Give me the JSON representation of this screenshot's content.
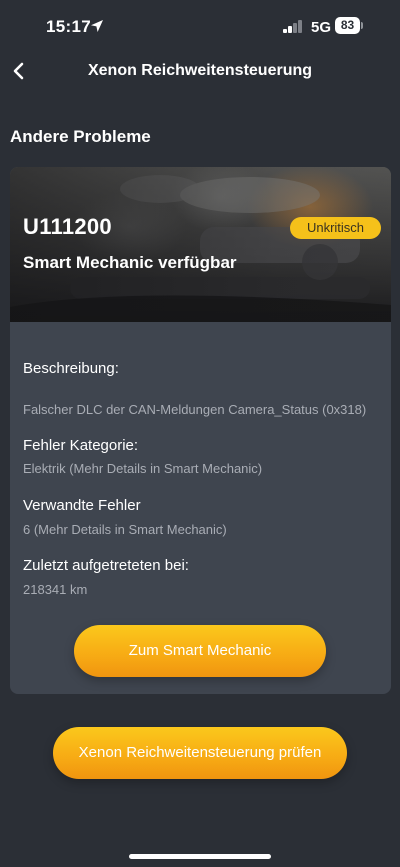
{
  "status_bar": {
    "time": "15:17",
    "network": "5G",
    "battery_level": "83",
    "location_icon": "location-arrow-icon",
    "signal_icon": "cellular-signal-icon"
  },
  "nav": {
    "back_icon": "chevron-left-icon",
    "title": "Xenon Reichweitensteuerung"
  },
  "section_title": "Andere Probleme",
  "card": {
    "hero": {
      "error_code": "U111200",
      "subtitle": "Smart Mechanic verfügbar",
      "severity": "Unkritisch"
    },
    "fields": [
      {
        "label": "Beschreibung:",
        "value": "Falscher DLC der CAN-Meldungen Camera_Status (0x318)"
      },
      {
        "label": "Fehler Kategorie:",
        "value": "Elektrik (Mehr Details in Smart Mechanic)"
      },
      {
        "label": "Verwandte Fehler",
        "value": "6 (Mehr Details in Smart Mechanic)"
      },
      {
        "label": "Zuletzt aufgetreteten bei:",
        "value": "218341 km"
      }
    ],
    "button_label": "Zum Smart Mechanic"
  },
  "check_button_label": "Xenon Reichweitensteuerung prüfen",
  "colors": {
    "background": "#2b2f36",
    "card": "#3f454f",
    "accent": "#f7aa14",
    "badge": "#f5c11a",
    "muted_text": "#a9adb5"
  }
}
